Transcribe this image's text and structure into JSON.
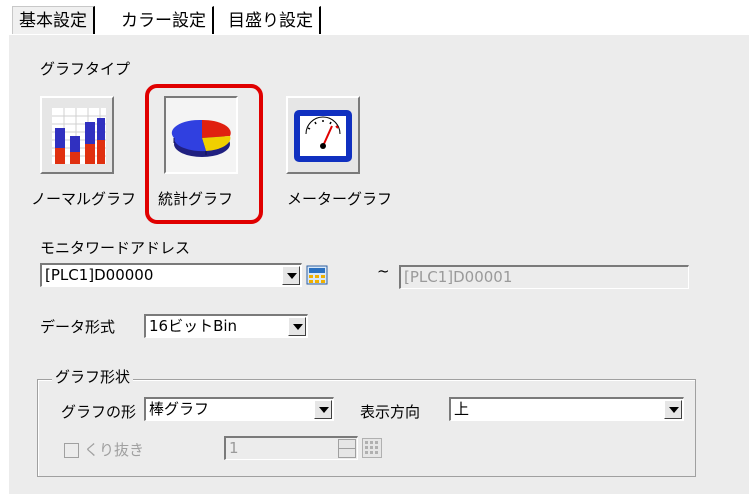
{
  "tabs": [
    {
      "label": "基本設定"
    },
    {
      "label": "カラー設定"
    },
    {
      "label": "目盛り設定"
    }
  ],
  "graph_type": {
    "label": "グラフタイプ",
    "options": [
      {
        "label": "ノーマルグラフ"
      },
      {
        "label": "統計グラフ"
      },
      {
        "label": "メーターグラフ"
      }
    ]
  },
  "monitor": {
    "label": "モニタワードアドレス",
    "address_value": "[PLC1]D00000",
    "tilde": "~",
    "end_address_value": "[PLC1]D00001"
  },
  "data_format": {
    "label": "データ形式",
    "value": "16ビットBin"
  },
  "graph_shape": {
    "group_title": "グラフ形状",
    "shape_label": "グラフの形",
    "shape_value": "棒グラフ",
    "direction_label": "表示方向",
    "direction_value": "上",
    "cutout_label": "くり抜き",
    "cutout_value": "1"
  }
}
